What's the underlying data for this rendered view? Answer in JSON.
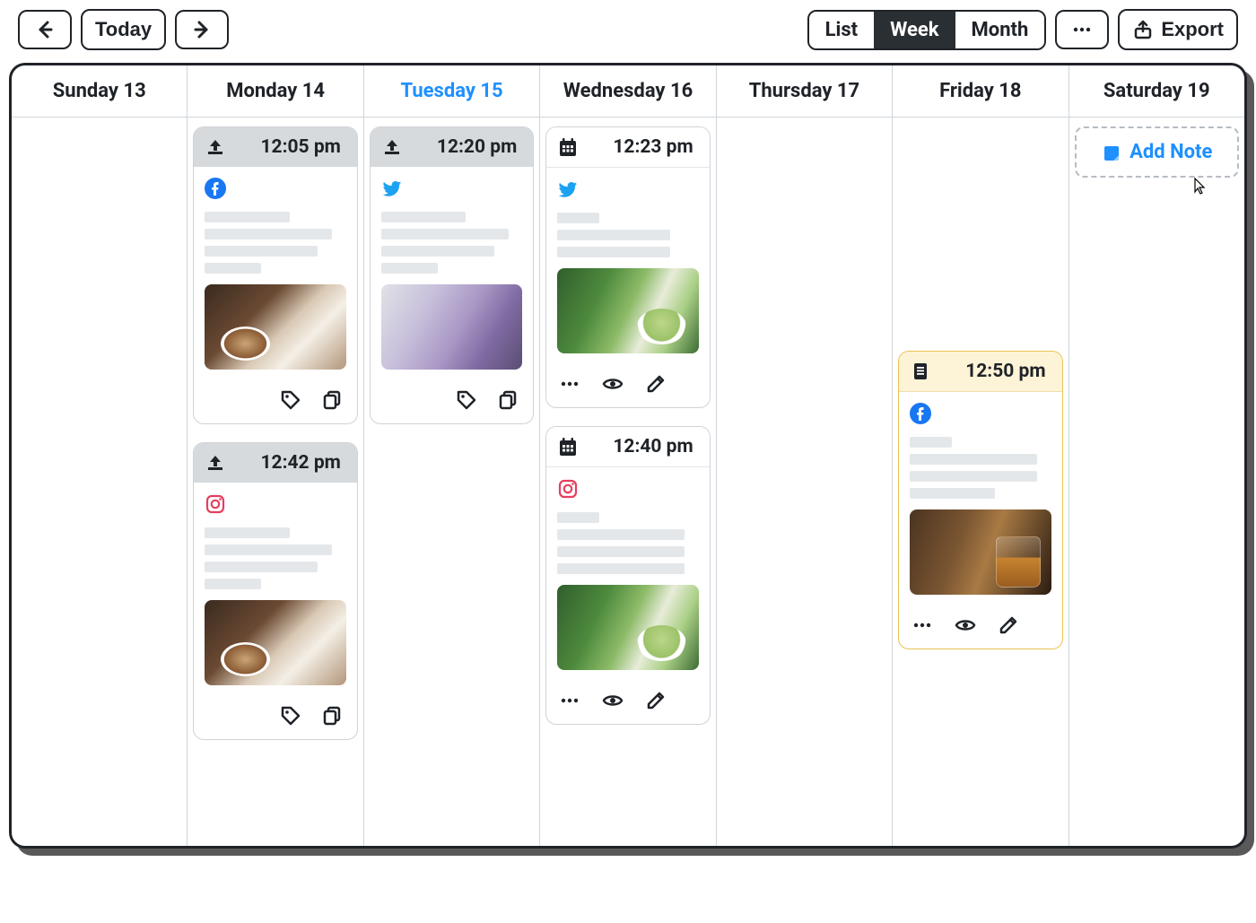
{
  "toolbar": {
    "today": "Today",
    "views": {
      "list": "List",
      "week": "Week",
      "month": "Month"
    },
    "export": "Export"
  },
  "days": [
    {
      "label": "Sunday 13",
      "today": false
    },
    {
      "label": "Monday 14",
      "today": false
    },
    {
      "label": "Tuesday 15",
      "today": true
    },
    {
      "label": "Wednesday 16",
      "today": false
    },
    {
      "label": "Thursday 17",
      "today": false
    },
    {
      "label": "Friday 18",
      "today": false
    },
    {
      "label": "Saturday 19",
      "today": false
    }
  ],
  "cards": {
    "mon1": {
      "time": "12:05 pm",
      "status": "pending",
      "platform": "facebook",
      "thumb": "coffee"
    },
    "mon2": {
      "time": "12:42 pm",
      "status": "pending",
      "platform": "instagram",
      "thumb": "coffee"
    },
    "tue1": {
      "time": "12:20 pm",
      "status": "pending",
      "platform": "twitter",
      "thumb": "lilac"
    },
    "wed1": {
      "time": "12:23 pm",
      "status": "scheduled",
      "platform": "twitter",
      "thumb": "matcha"
    },
    "wed2": {
      "time": "12:40 pm",
      "status": "scheduled",
      "platform": "instagram",
      "thumb": "matcha"
    },
    "fri1": {
      "time": "12:50 pm",
      "status": "draft",
      "platform": "facebook",
      "thumb": "whiskey"
    }
  },
  "addNote": "Add Note"
}
